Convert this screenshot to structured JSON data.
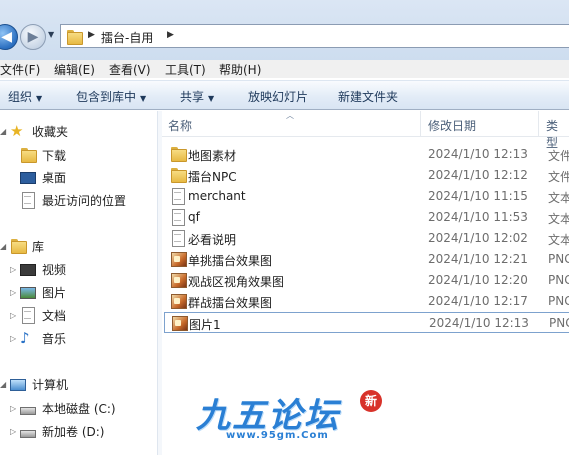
{
  "address_bar": {
    "path": [
      "擂台-自用"
    ]
  },
  "menu": [
    {
      "label": "文件(F)"
    },
    {
      "label": "编辑(E)"
    },
    {
      "label": "查看(V)"
    },
    {
      "label": "工具(T)"
    },
    {
      "label": "帮助(H)"
    }
  ],
  "toolbar": {
    "organize": "组织",
    "include_library": "包含到库中",
    "share": "共享",
    "slideshow": "放映幻灯片",
    "new_folder": "新建文件夹"
  },
  "nav": {
    "favorites": "收藏夹",
    "downloads": "下载",
    "desktop": "桌面",
    "recent": "最近访问的位置",
    "libraries": "库",
    "videos": "视频",
    "pictures": "图片",
    "documents": "文档",
    "music": "音乐",
    "computer": "计算机",
    "local_disk": "本地磁盘 (C:)",
    "new_volume": "新加卷 (D:)"
  },
  "columns": {
    "name": "名称",
    "date": "修改日期",
    "type": "类型"
  },
  "files": [
    {
      "name": "地图素材",
      "date": "2024/1/10 12:13",
      "type": "文件",
      "icon": "folder-icon"
    },
    {
      "name": "擂台NPC",
      "date": "2024/1/10 12:12",
      "type": "文件",
      "icon": "folder-icon"
    },
    {
      "name": "merchant",
      "date": "2024/1/10 11:15",
      "type": "文本",
      "icon": "text-file-icon"
    },
    {
      "name": "qf",
      "date": "2024/1/10 11:53",
      "type": "文本",
      "icon": "text-file-icon"
    },
    {
      "name": "必看说明",
      "date": "2024/1/10 12:02",
      "type": "文本",
      "icon": "text-file-icon"
    },
    {
      "name": "单挑擂台效果图",
      "date": "2024/1/10 12:21",
      "type": "PNG",
      "icon": "image-file-icon"
    },
    {
      "name": "观战区视角效果图",
      "date": "2024/1/10 12:20",
      "type": "PNG",
      "icon": "image-file-icon"
    },
    {
      "name": "群战擂台效果图",
      "date": "2024/1/10 12:17",
      "type": "PNG",
      "icon": "image-file-icon"
    },
    {
      "name": "图片1",
      "date": "2024/1/10 12:13",
      "type": "PNG",
      "icon": "image-file-icon"
    }
  ],
  "watermark": {
    "title": "九五论坛",
    "url": "www.95gm.Com",
    "seal": "新"
  },
  "colors": {
    "accent": "#2a7fd4",
    "selection_border": "#7da2ce",
    "toolbar_text": "#1e395b"
  }
}
